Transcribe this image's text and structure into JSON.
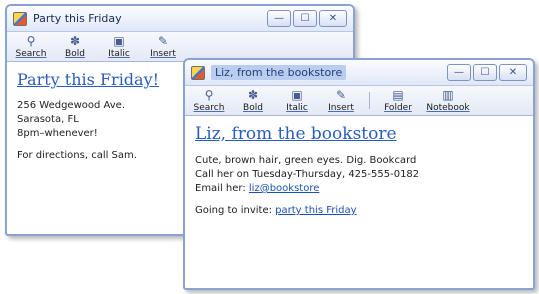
{
  "windows": {
    "back": {
      "title": "Party this Friday",
      "controls": {
        "minimize": "—",
        "maximize": "☐",
        "close": "✕"
      },
      "toolbar": [
        {
          "label": "Search",
          "icon": "⚲"
        },
        {
          "label": "Bold",
          "icon": "✽"
        },
        {
          "label": "Italic",
          "icon": "▣"
        },
        {
          "label": "Insert",
          "icon": "✎"
        }
      ],
      "content": {
        "heading": "Party this Friday!",
        "address_line1": "256 Wedgewood Ave.",
        "address_line2": "Sarasota, FL",
        "time": "8pm–whenever!",
        "directions": "For directions, call Sam."
      }
    },
    "front": {
      "title": "Liz, from the bookstore",
      "controls": {
        "minimize": "—",
        "maximize": "☐",
        "close": "✕"
      },
      "toolbar": [
        {
          "label": "Search",
          "icon": "⚲"
        },
        {
          "label": "Bold",
          "icon": "✽"
        },
        {
          "label": "Italic",
          "icon": "▣"
        },
        {
          "label": "Insert",
          "icon": "✎"
        }
      ],
      "toolbar_extra": [
        {
          "label": "Folder",
          "icon": "▤"
        },
        {
          "label": "Notebook",
          "icon": "▥"
        }
      ],
      "content": {
        "heading": "Liz, from the bookstore",
        "line1": "Cute, brown hair, green eyes. Dig. Bookcard",
        "line2": "Call her on Tuesday-Thursday, 425-555-0182",
        "email_prefix": "Email her:",
        "email_link": "liz@bookstore",
        "invite_prefix": "Going to invite:",
        "invite_link": "party this Friday"
      }
    }
  }
}
